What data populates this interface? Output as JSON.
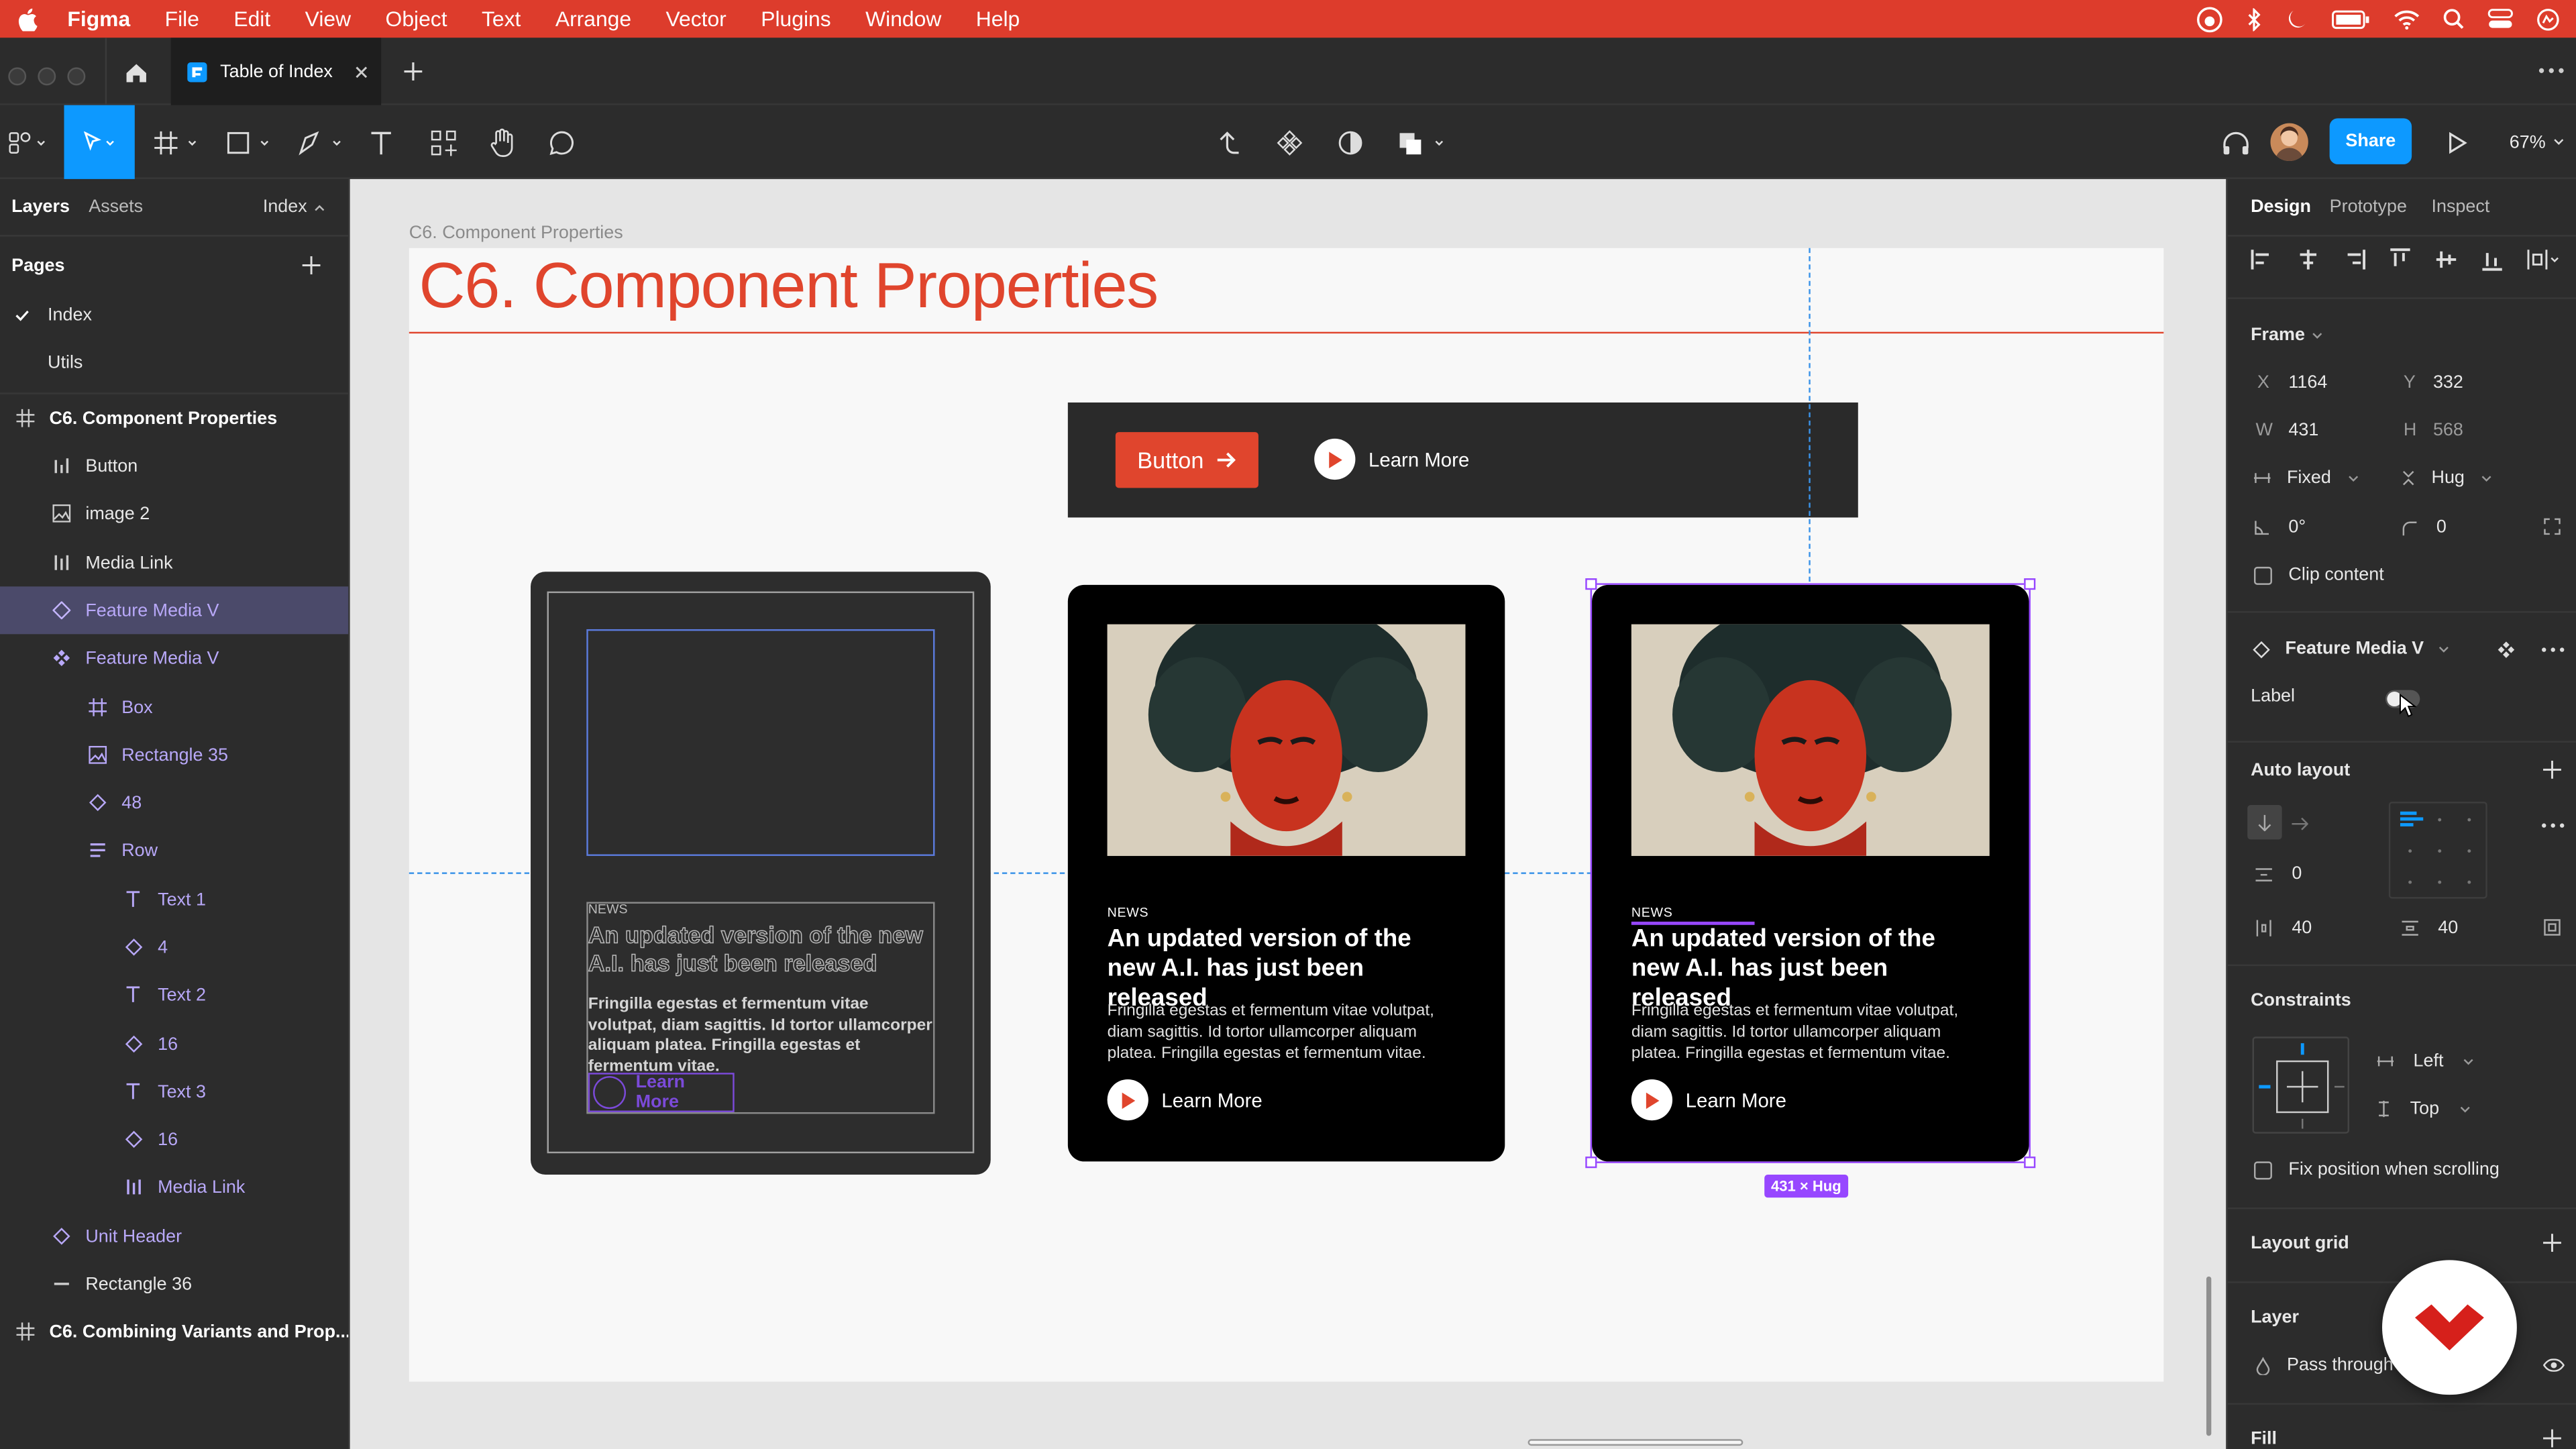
{
  "menubar": {
    "app": "Figma",
    "items": [
      "File",
      "Edit",
      "View",
      "Object",
      "Text",
      "Arrange",
      "Vector",
      "Plugins",
      "Window",
      "Help"
    ]
  },
  "tabbar": {
    "tab_title": "Table of Index"
  },
  "toolbar": {
    "share_label": "Share",
    "zoom": "67%"
  },
  "left_panel": {
    "tabs": [
      "Layers",
      "Assets"
    ],
    "page_switch": "Index",
    "pages_header": "Pages",
    "pages": [
      "Index",
      "Utils"
    ],
    "layers": [
      {
        "label": "C6. Component Properties",
        "type": "frame"
      },
      {
        "label": "Button",
        "type": "bar"
      },
      {
        "label": "image 2",
        "type": "image"
      },
      {
        "label": "Media Link",
        "type": "bar"
      },
      {
        "label": "Feature Media V",
        "type": "component-instance"
      },
      {
        "label": "Feature Media V",
        "type": "component-main"
      },
      {
        "label": "Box",
        "type": "box"
      },
      {
        "label": "Rectangle 35",
        "type": "image"
      },
      {
        "label": "48",
        "type": "diamond"
      },
      {
        "label": "Row",
        "type": "row"
      },
      {
        "label": "Text 1",
        "type": "text"
      },
      {
        "label": "4",
        "type": "diamond"
      },
      {
        "label": "Text 2",
        "type": "text"
      },
      {
        "label": "16",
        "type": "diamond"
      },
      {
        "label": "Text 3",
        "type": "text"
      },
      {
        "label": "16",
        "type": "diamond"
      },
      {
        "label": "Media Link",
        "type": "bar"
      },
      {
        "label": "Unit Header",
        "type": "diamond"
      },
      {
        "label": "Rectangle 36",
        "type": "line"
      },
      {
        "label": "C6. Combining Variants and Prop...",
        "type": "frame"
      }
    ]
  },
  "canvas": {
    "frame_label": "C6. Component Properties",
    "title": "C6.  Component Properties",
    "button_label": "Button",
    "learn_more": "Learn More",
    "card_news": "NEWS",
    "card_heading": "An updated version of the new A.I. has just been released",
    "card_body": "Fringilla egestas et fermentum vitae volutpat, diam sagittis. Id tortor ullamcorper aliquam platea. Fringilla egestas et fermentum vitae.",
    "size_badge": "431 × Hug"
  },
  "right_panel": {
    "tabs": [
      "Design",
      "Prototype",
      "Inspect"
    ],
    "frame_header": "Frame",
    "x_label": "X",
    "x": "1164",
    "y_label": "Y",
    "y": "332",
    "w_label": "W",
    "w": "431",
    "h_label": "H",
    "h": "568",
    "width_mode": "Fixed",
    "height_mode": "Hug",
    "rotation": "0°",
    "radius": "0",
    "clip_content": "Clip content",
    "component_name": "Feature Media V",
    "prop_label": "Label",
    "auto_layout": "Auto layout",
    "gap": "0",
    "padding_h": "40",
    "padding_v": "40",
    "constraints": "Constraints",
    "constraint_h": "Left",
    "constraint_v": "Top",
    "fix_position": "Fix position when scrolling",
    "layout_grid": "Layout grid",
    "layer": "Layer",
    "blend": "Pass through",
    "fill": "Fill"
  },
  "colors": {
    "menubar": "#dd3c2c",
    "accent_red": "#e0452d",
    "selection": "#9747ff",
    "share": "#0d99ff"
  }
}
